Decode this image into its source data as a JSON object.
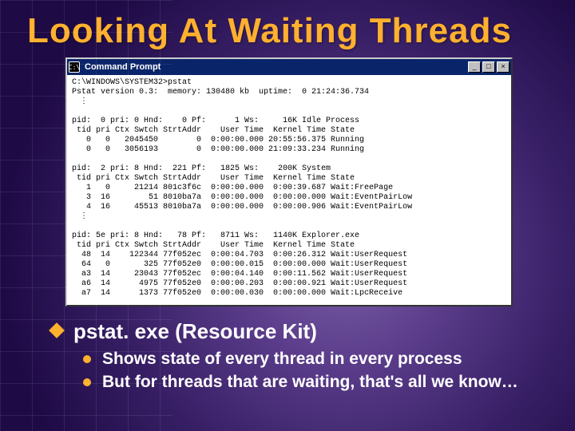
{
  "title": "Looking At Waiting Threads",
  "window": {
    "title": "Command Prompt",
    "sysicon_label": "C:\\",
    "min": "_",
    "max": "□",
    "close": "×"
  },
  "console": {
    "line1": "C:\\WINDOWS\\SYSTEM32>pstat",
    "line2": "Pstat version 0.3:  memory: 130480 kb  uptime:  0 21:24:36.734",
    "p0_hdr": "pid:  0 pri: 0 Hnd:    0 Pf:      1 Ws:     16K Idle Process",
    "cols": " tid pri Ctx Swtch StrtAddr    User Time  Kernel Time State",
    "p0_r1": "   0   0   2045450        0  0:00:00.000 20:55:56.375 Running",
    "p0_r2": "   0   0   3056193        0  0:00:00.000 21:09:33.234 Running",
    "p1_hdr": "pid:  2 pri: 8 Hnd:  221 Pf:   1825 Ws:    200K System",
    "p1_r1": "   1   0     21214 801c3f6c  0:00:00.000  0:00:39.687 Wait:FreePage",
    "p1_r2": "   3  16        51 8010ba7a  0:00:00.000  0:00:00.000 Wait:EventPairLow",
    "p1_r3": "   4  16     45513 8010ba7a  0:00:00.000  0:00:00.906 Wait:EventPairLow",
    "p2_hdr": "pid: 5e pri: 8 Hnd:   78 Pf:   8711 Ws:   1140K Explorer.exe",
    "p2_r1": "  48  14    122344 77f052ec  0:00:04.703  0:00:26.312 Wait:UserRequest",
    "p2_r2": "  64   0       325 77f052e0  0:00:00.015  0:00:00.000 Wait:UserRequest",
    "p2_r3": "  a3  14     23043 77f052ec  0:00:04.140  0:00:11.562 Wait:UserRequest",
    "p2_r4": "  a6  14      4975 77f052e0  0:00:00.203  0:00:00.921 Wait:UserRequest",
    "p2_r5": "  a7  14      1373 77f052e0  0:00:00.030  0:00:00.000 Wait:LpcReceive"
  },
  "bullets": {
    "main": "pstat. exe (Resource Kit)",
    "sub1": "Shows state of every thread in every process",
    "sub2": "But for threads that are waiting, that's all we know…"
  }
}
